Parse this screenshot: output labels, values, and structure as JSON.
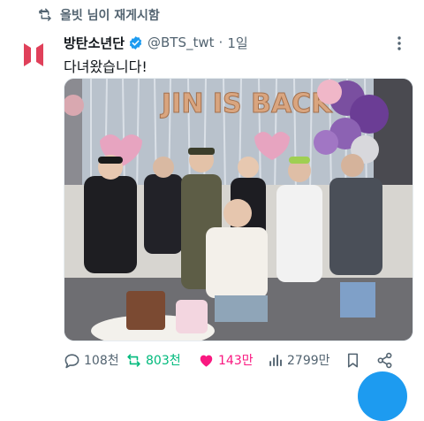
{
  "retweet": {
    "text": "올빗 님이 재게시함"
  },
  "tweet": {
    "display_name": "방탄소년단",
    "handle": "@BTS_twt",
    "separator": "·",
    "time": "1일",
    "text": "다녀왔습니다!",
    "image_banner_text": "JIN IS BACK"
  },
  "actions": {
    "replies": "108천",
    "retweets": "803천",
    "likes": "143만",
    "views": "2799만"
  },
  "colors": {
    "accent": "#1d9bf0",
    "retweet_green": "#00ba7c",
    "like_pink": "#f91880",
    "muted": "#536471",
    "bts_logo": "#e0405a"
  },
  "icons": [
    "retweet-icon",
    "bts-logo",
    "verified-badge-icon",
    "more-icon",
    "reply-icon",
    "like-icon",
    "views-icon",
    "bookmark-icon",
    "share-icon"
  ]
}
